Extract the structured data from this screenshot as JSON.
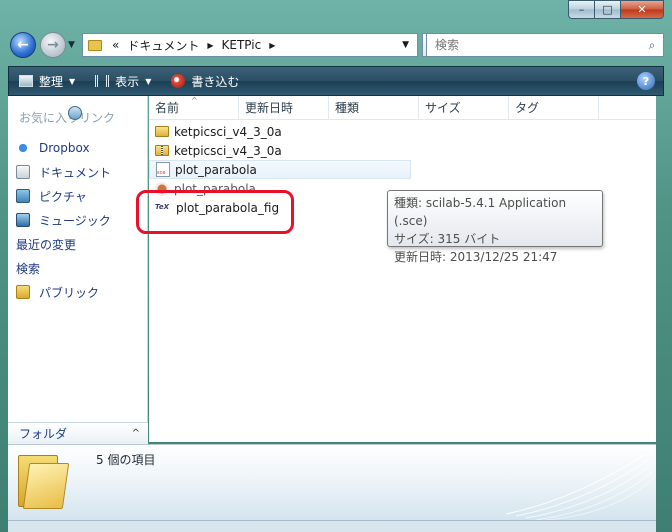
{
  "window": {
    "min_label": "–",
    "max_label": "□",
    "close_label": "✕"
  },
  "nav": {
    "recent_glyph": "▼",
    "breadcrumb": [
      "«",
      "ドキュメント",
      "KETPic"
    ],
    "search_placeholder": "検索"
  },
  "toolbar": {
    "organize": "整理",
    "view": "表示",
    "burn": "書き込む",
    "help": "?"
  },
  "sidebar": {
    "heading": "お気に入りリンク",
    "items": [
      {
        "label": "Dropbox",
        "icon": "dropbox-icon"
      },
      {
        "label": "ドキュメント",
        "icon": "documents-icon"
      },
      {
        "label": "ピクチャ",
        "icon": "pictures-icon"
      },
      {
        "label": "ミュージック",
        "icon": "music-icon"
      },
      {
        "label": "最近の変更",
        "icon": "recent-changes-icon"
      },
      {
        "label": "検索",
        "icon": "search-folder-icon"
      },
      {
        "label": "パブリック",
        "icon": "public-folder-icon"
      }
    ],
    "folders_label": "フォルダ",
    "folders_toggle": "^"
  },
  "columns": [
    "名前",
    "更新日時",
    "種類",
    "サイズ",
    "タグ"
  ],
  "files": [
    {
      "name": "ketpicsci_v4_3_0a",
      "icon": "folder-icon"
    },
    {
      "name": "ketpicsci_v4_3_0a",
      "icon": "zip-folder-icon"
    },
    {
      "name": "plot_parabola",
      "icon": "sce-file-icon"
    },
    {
      "name": "plot_parabola",
      "icon": "template-file-icon"
    },
    {
      "name": "plot_parabola_fig",
      "icon": "tex-file-icon"
    }
  ],
  "tooltip": {
    "type_line": "種類: scilab-5.4.1 Application (.sce)",
    "size_line": "サイズ: 315 バイト",
    "modified_line": "更新日時: 2013/12/25 21:47"
  },
  "details": {
    "item_count": "5 個の項目"
  },
  "colors": {
    "highlight": "#e8102a",
    "toolbar": "#2a4e63",
    "link": "#1e3a80"
  }
}
